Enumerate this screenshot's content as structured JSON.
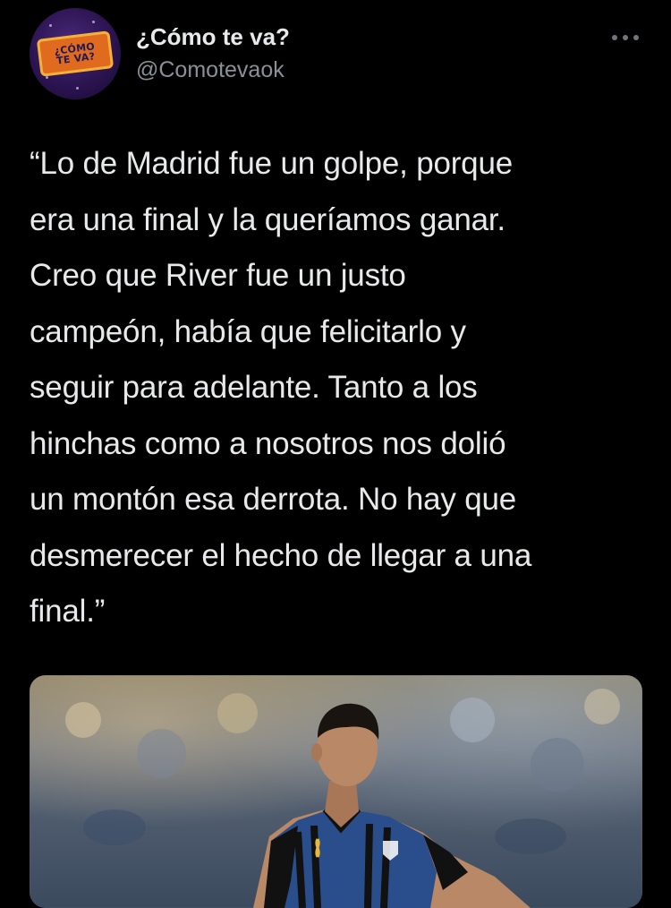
{
  "account": {
    "display_name": "¿Cómo te va?",
    "handle": "@Comotevaok",
    "avatar_logo_text": [
      "¿CÓMO",
      "TE VA?"
    ]
  },
  "more_icon": "more-horizontal-icon",
  "tweet": {
    "lines": [
      "“Lo de Madrid fue un golpe, porque",
      "era una final y la queríamos ganar.",
      "Creo que River fue un justo",
      "campeón, había que felicitarlo y",
      "seguir para adelante. Tanto a los",
      "hinchas como a nosotros nos dolió",
      "un montón esa derrota. No hay que",
      "desmerecer el hecho de llegar a una",
      "final.”"
    ]
  },
  "colors": {
    "background": "#000000",
    "text_primary": "#e7e9ea",
    "text_secondary": "#8b9096",
    "avatar_purple": "#2c1452",
    "avatar_orange": "#e06a1e",
    "jersey_blue": "#2a4e8c",
    "jersey_black": "#111111"
  }
}
